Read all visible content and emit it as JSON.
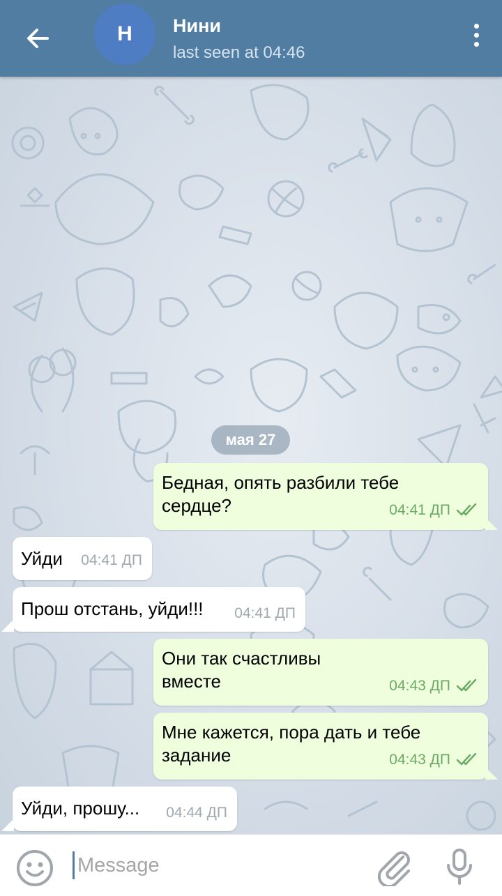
{
  "header": {
    "avatar_letter": "Н",
    "name": "Нини",
    "status": "last seen at 04:46"
  },
  "chat": {
    "date_separator": "мая 27",
    "messages": [
      {
        "direction": "out",
        "text": "Бедная, опять разбили тебе\nсердце?",
        "time": "04:41 ДП",
        "read": true
      },
      {
        "direction": "in",
        "text": "Уйди",
        "time": "04:41 ДП"
      },
      {
        "direction": "in",
        "text": "Прош отстань, уйди!!!",
        "time": "04:41 ДП"
      },
      {
        "direction": "out",
        "text": "Они так счастливы\nвместе",
        "time": "04:43 ДП",
        "read": true
      },
      {
        "direction": "out",
        "text": "Мне кажется, пора дать и тебе\nзадание",
        "time": "04:43 ДП",
        "read": true
      },
      {
        "direction": "in",
        "text": "Уйди, прошу...",
        "time": "04:44 ДП"
      }
    ]
  },
  "input": {
    "placeholder": "Message"
  },
  "icons": {
    "back": "arrow-left-icon",
    "menu": "more-vertical-icon",
    "emoji": "smiley-icon",
    "attach": "paperclip-icon",
    "mic": "microphone-icon",
    "read": "double-check-icon"
  },
  "colors": {
    "header": "#517da2",
    "outgoing_bubble": "#effedd",
    "incoming_bubble": "#ffffff",
    "check": "#6aaa64"
  }
}
